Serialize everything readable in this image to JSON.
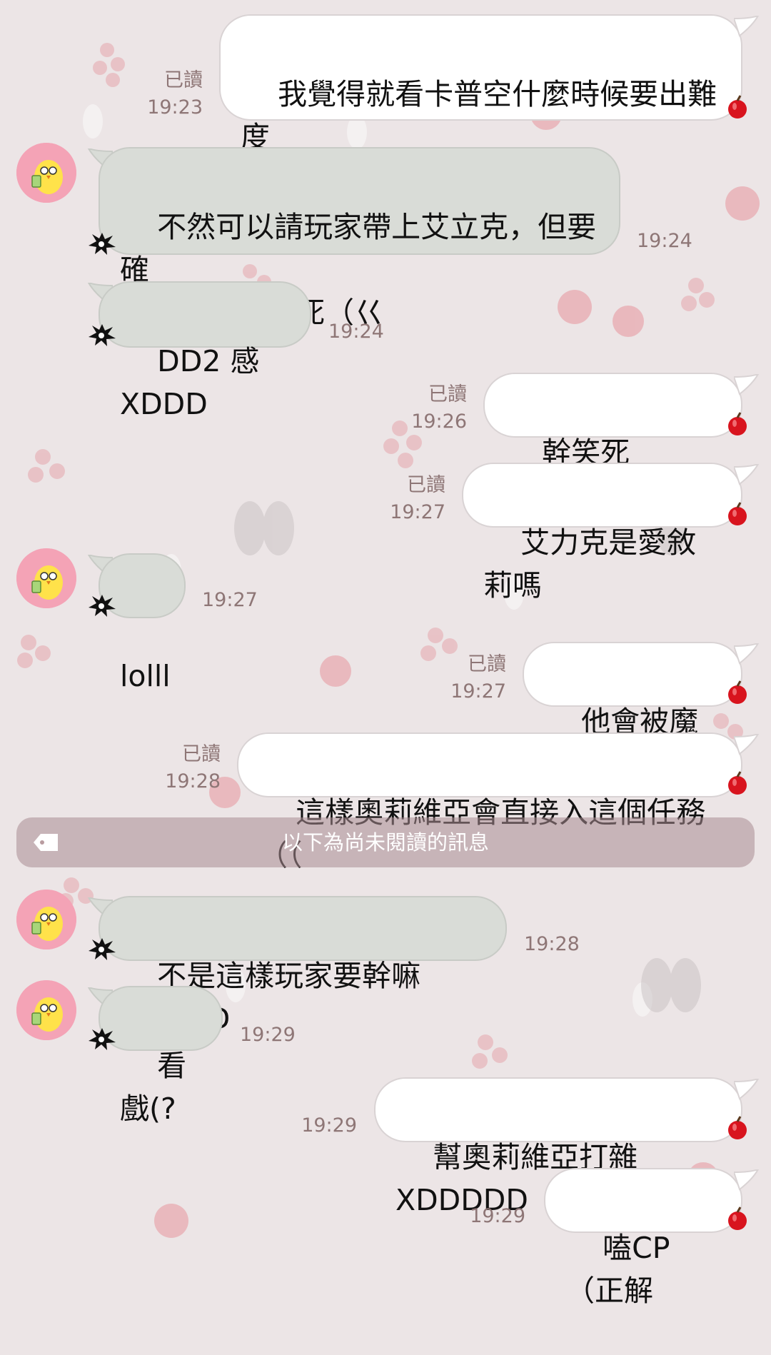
{
  "unread_divider": "以下為尚未閱讀的訊息",
  "messages": [
    {
      "side": "sent",
      "text": "我覺得就看卡普空什麼時候要出難度\n高的怪ㄅ",
      "read": "已讀",
      "time": "19:23"
    },
    {
      "side": "recv",
      "text": "不然可以請玩家帶上艾立克，但要確\n保艾立克不會死（巜",
      "time": "19:24"
    },
    {
      "side": "recv",
      "text": "DD2 感XDDD",
      "time": "19:24"
    },
    {
      "side": "sent",
      "text": "幹笑死XDDDD d",
      "read": "已讀",
      "time": "19:26"
    },
    {
      "side": "sent",
      "text": "艾力克是愛敘莉嗎",
      "read": "已讀",
      "time": "19:27"
    },
    {
      "side": "recv",
      "text": "lolll",
      "time": "19:27"
    },
    {
      "side": "sent",
      "text": "他會被魔物追",
      "read": "已讀",
      "time": "19:27"
    },
    {
      "side": "sent",
      "text": "這樣奧莉維亞會直接入這個任務（（",
      "read": "已讀",
      "time": "19:28"
    },
    {
      "side": "recv",
      "text": "不是這樣玩家要幹嘛XDDDD",
      "time": "19:28"
    },
    {
      "side": "recv",
      "text": "看戲(?",
      "time": "19:29"
    },
    {
      "side": "sent",
      "text": "幫奧莉維亞打雜XDDDDD",
      "time": "19:29"
    },
    {
      "side": "sent",
      "text": "嗑CP（正解",
      "time": "19:29"
    }
  ],
  "colors": {
    "background": "#ece5e6",
    "sent_bubble": "#ffffff",
    "received_bubble": "#d9dcd7",
    "meta_text": "#8e7676",
    "avatar_bg": "#f4a3b6",
    "apple": "#d8141e"
  },
  "icons": {
    "avatar": "yellow-bird-avatar-icon",
    "sent_tail": "apple-icon",
    "received_tail": "splat-icon",
    "divider": "tag-icon"
  }
}
